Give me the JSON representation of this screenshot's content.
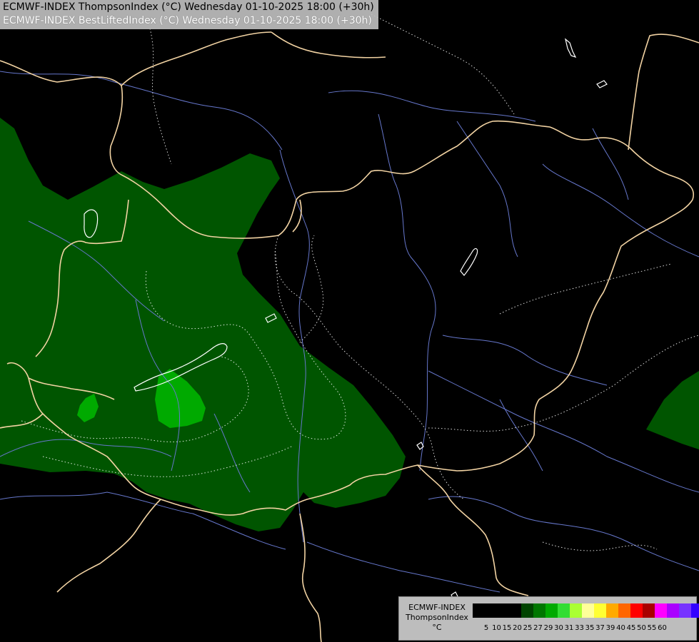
{
  "header": {
    "line1": "ECMWF-INDEX ThompsonIndex (°C) Wednesday 01-10-2025 18:00 (+30h)",
    "line2": "ECMWF-INDEX BestLiftedIndex (°C) Wednesday 01-10-2025 18:00 (+30h)"
  },
  "legend": {
    "title_line1": "ECMWF-INDEX",
    "title_line2": "ThompsonIndex",
    "title_line3": "°C",
    "colors": [
      "#000000",
      "#000000",
      "#000000",
      "#000000",
      "#004400",
      "#007700",
      "#00aa00",
      "#33dd33",
      "#aaff33",
      "#ffff99",
      "#ffff33",
      "#ffaa00",
      "#ff6600",
      "#ff0000",
      "#aa0000",
      "#ff00ff",
      "#aa00ff",
      "#7733ff",
      "#3300ff",
      "#0000ff"
    ],
    "labels": [
      "5",
      "10",
      "15",
      "20",
      "25",
      "27",
      "29",
      "30",
      "31",
      "33",
      "35",
      "37",
      "39",
      "40",
      "45",
      "50",
      "55",
      "60"
    ]
  },
  "map_colors": {
    "background": "#000000",
    "field_25_27": "#005500",
    "field_27_29": "#00aa00",
    "borders": "#f2d3a3",
    "rivers": "#6677cc",
    "lakes": "#ffffff",
    "lifted_index_contours": "#ffffff"
  }
}
